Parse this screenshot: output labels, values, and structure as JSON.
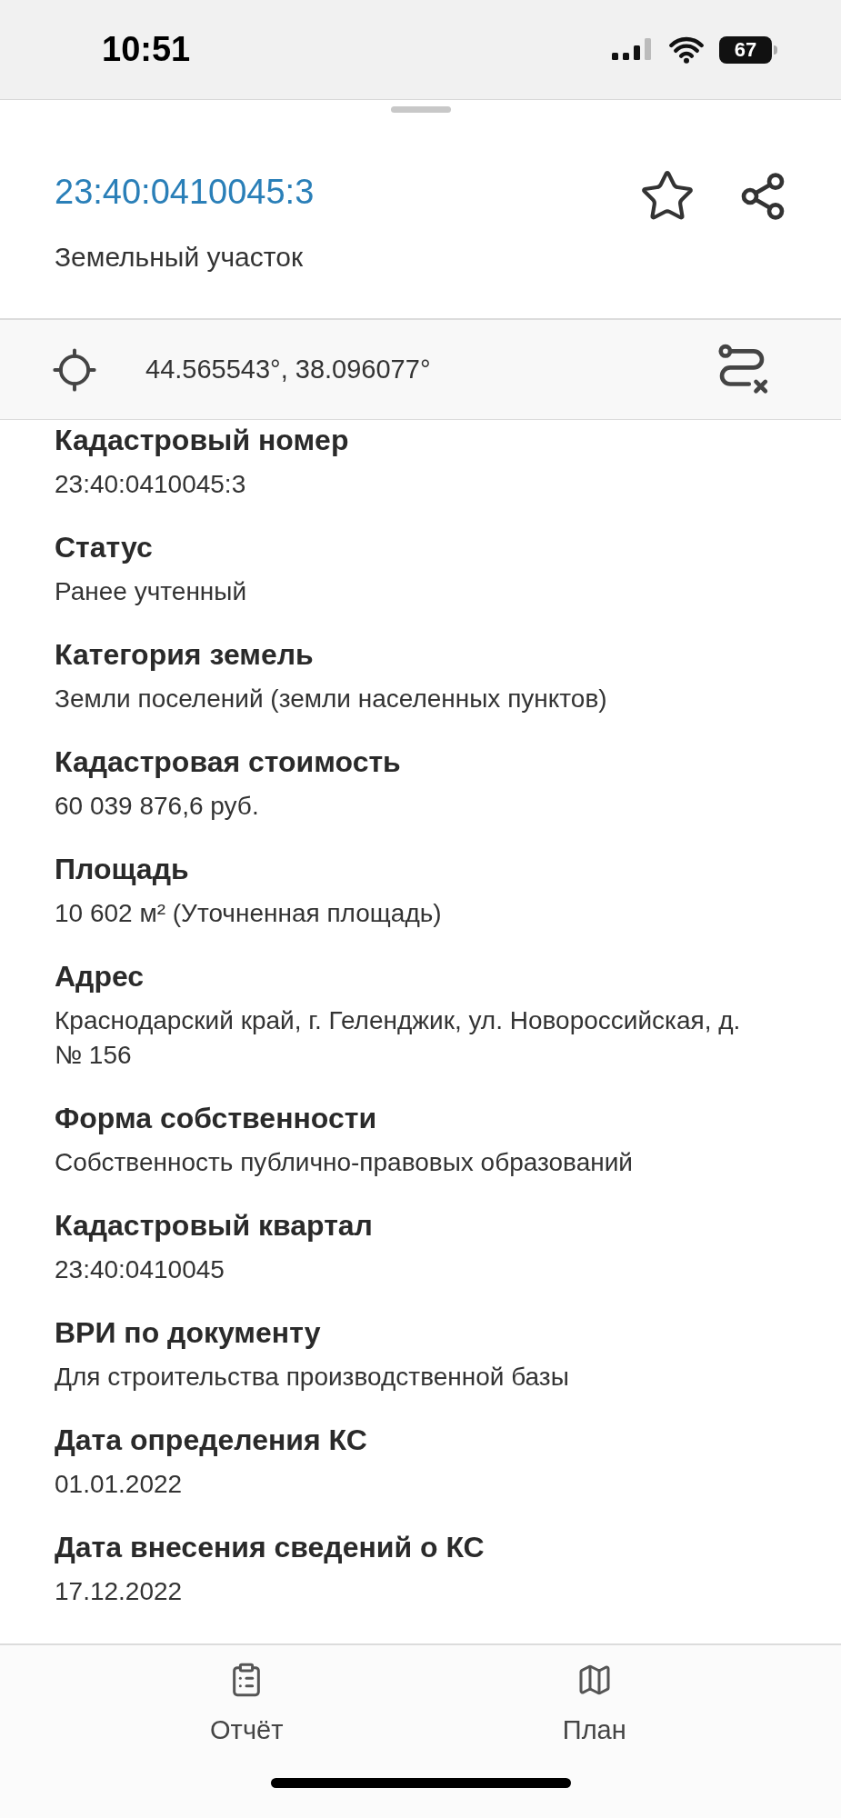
{
  "status_bar": {
    "time": "10:51",
    "battery": "67"
  },
  "header": {
    "title": "23:40:0410045:3",
    "subtitle": "Земельный участок"
  },
  "coordinates": "44.565543°, 38.096077°",
  "fields": [
    {
      "label": "Кадастровый номер",
      "value": "23:40:0410045:3"
    },
    {
      "label": "Статус",
      "value": "Ранее учтенный"
    },
    {
      "label": "Категория земель",
      "value": "Земли поселений (земли населенных пунктов)"
    },
    {
      "label": "Кадастровая стоимость",
      "value": "60 039 876,6 руб."
    },
    {
      "label": "Площадь",
      "value": "10 602 м² (Уточненная площадь)"
    },
    {
      "label": "Адрес",
      "value": "Краснодарский край, г. Геленджик, ул. Новороссийская, д. № 156"
    },
    {
      "label": "Форма собственности",
      "value": "Собственность публично-правовых образований"
    },
    {
      "label": "Кадастровый квартал",
      "value": "23:40:0410045"
    },
    {
      "label": "ВРИ по документу",
      "value": "Для строительства производственной базы"
    },
    {
      "label": "Дата определения КС",
      "value": "01.01.2022"
    },
    {
      "label": "Дата внесения сведений о КС",
      "value": "17.12.2022"
    }
  ],
  "bottom_nav": [
    {
      "kind": "report",
      "label": "Отчёт"
    },
    {
      "kind": "map",
      "label": "План"
    }
  ]
}
